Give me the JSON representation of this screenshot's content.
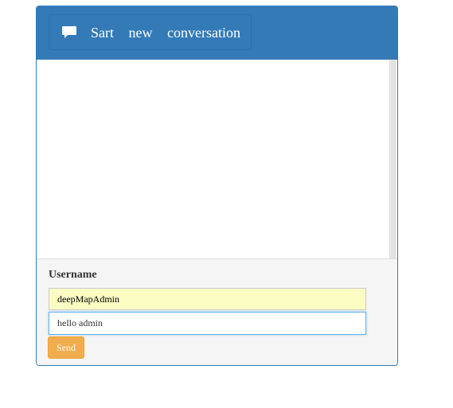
{
  "header": {
    "new_conversation_label": "Sart new conversation",
    "icon": "chat-bubble-icon"
  },
  "form": {
    "username_label": "Username",
    "username_value": "deepMapAdmin",
    "message_value": "hello admin",
    "send_label": "Send"
  },
  "colors": {
    "primary": "#337ab7",
    "warning": "#f0ad4e",
    "autofill": "#fafcc2",
    "footer_bg": "#f5f5f5"
  }
}
